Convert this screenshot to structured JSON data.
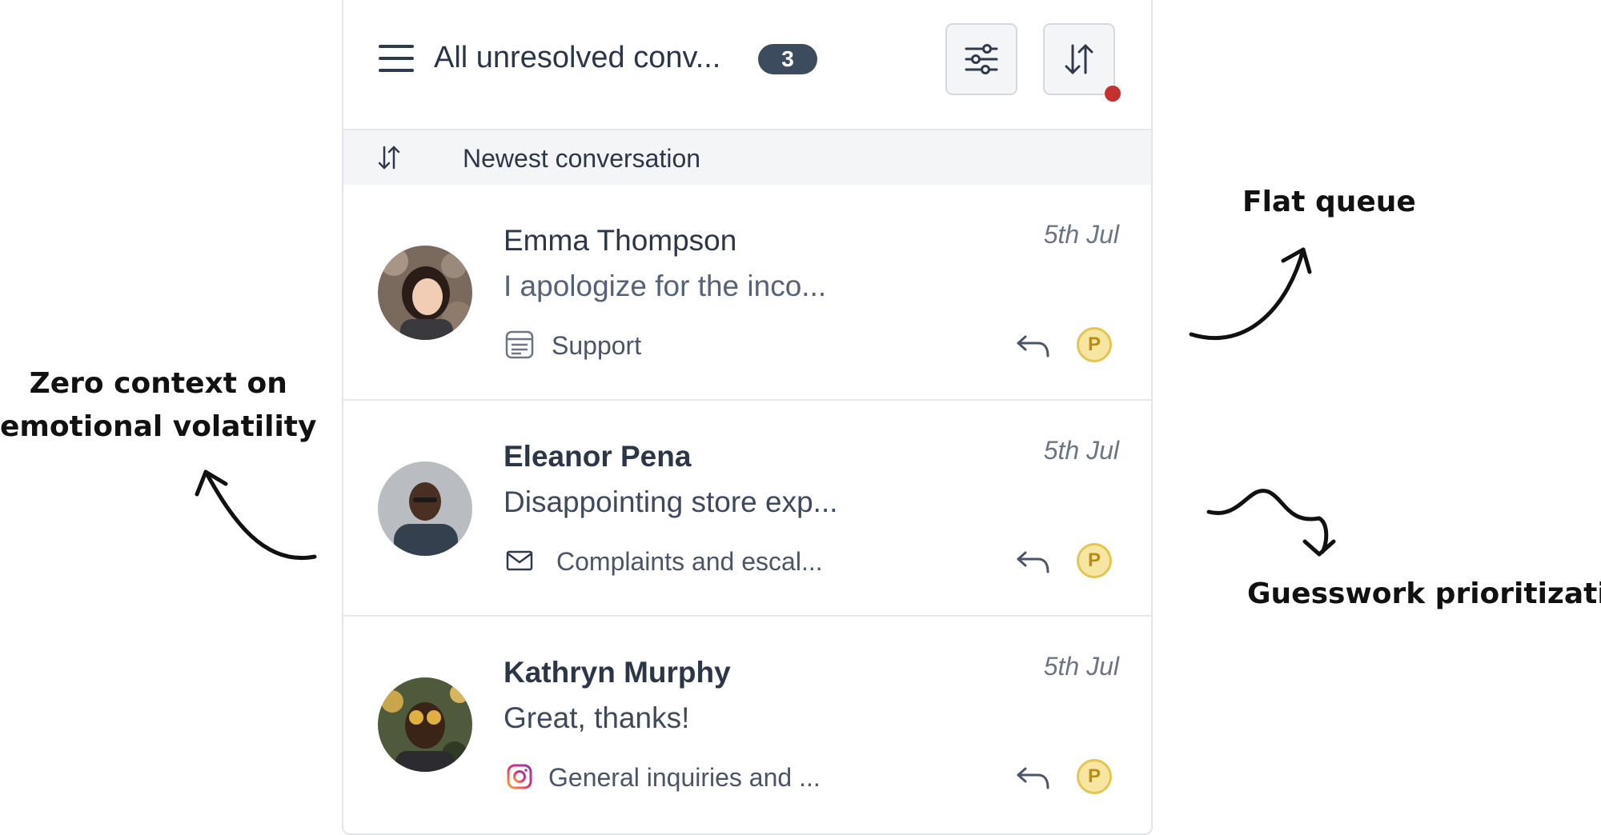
{
  "header": {
    "view_title": "All unresolved conv...",
    "count": "3",
    "filter_icon": "sliders-icon",
    "sort_icon": "sort-arrows-icon",
    "notification_color": "#c53030"
  },
  "sort_bar": {
    "icon": "sort-arrows-icon",
    "label": "Newest conversation"
  },
  "conversations": [
    {
      "name": "Emma Thompson",
      "unread": false,
      "date": "5th Jul",
      "preview": "I apologize for the inco...",
      "channel": "Support",
      "channel_icon": "support-form-icon",
      "assignee": "P"
    },
    {
      "name": "Eleanor Pena",
      "unread": true,
      "date": "5th Jul",
      "preview": "Disappointing store exp...",
      "channel": "Complaints and escal...",
      "channel_icon": "mail-icon",
      "assignee": "P"
    },
    {
      "name": "Kathryn Murphy",
      "unread": true,
      "date": "5th Jul",
      "preview": "Great, thanks!",
      "channel": "General inquiries and ...",
      "channel_icon": "instagram-icon",
      "assignee": "P"
    }
  ],
  "annotations": {
    "flat_queue": "Flat queue",
    "zero_context_line1": "Zero context on",
    "zero_context_line2": "emotional volatility",
    "guesswork": "Guesswork prioritization"
  },
  "colors": {
    "badge": "#3d4b5e",
    "assignee_fill": "#f7e6a1",
    "assignee_border": "#e4c552"
  }
}
